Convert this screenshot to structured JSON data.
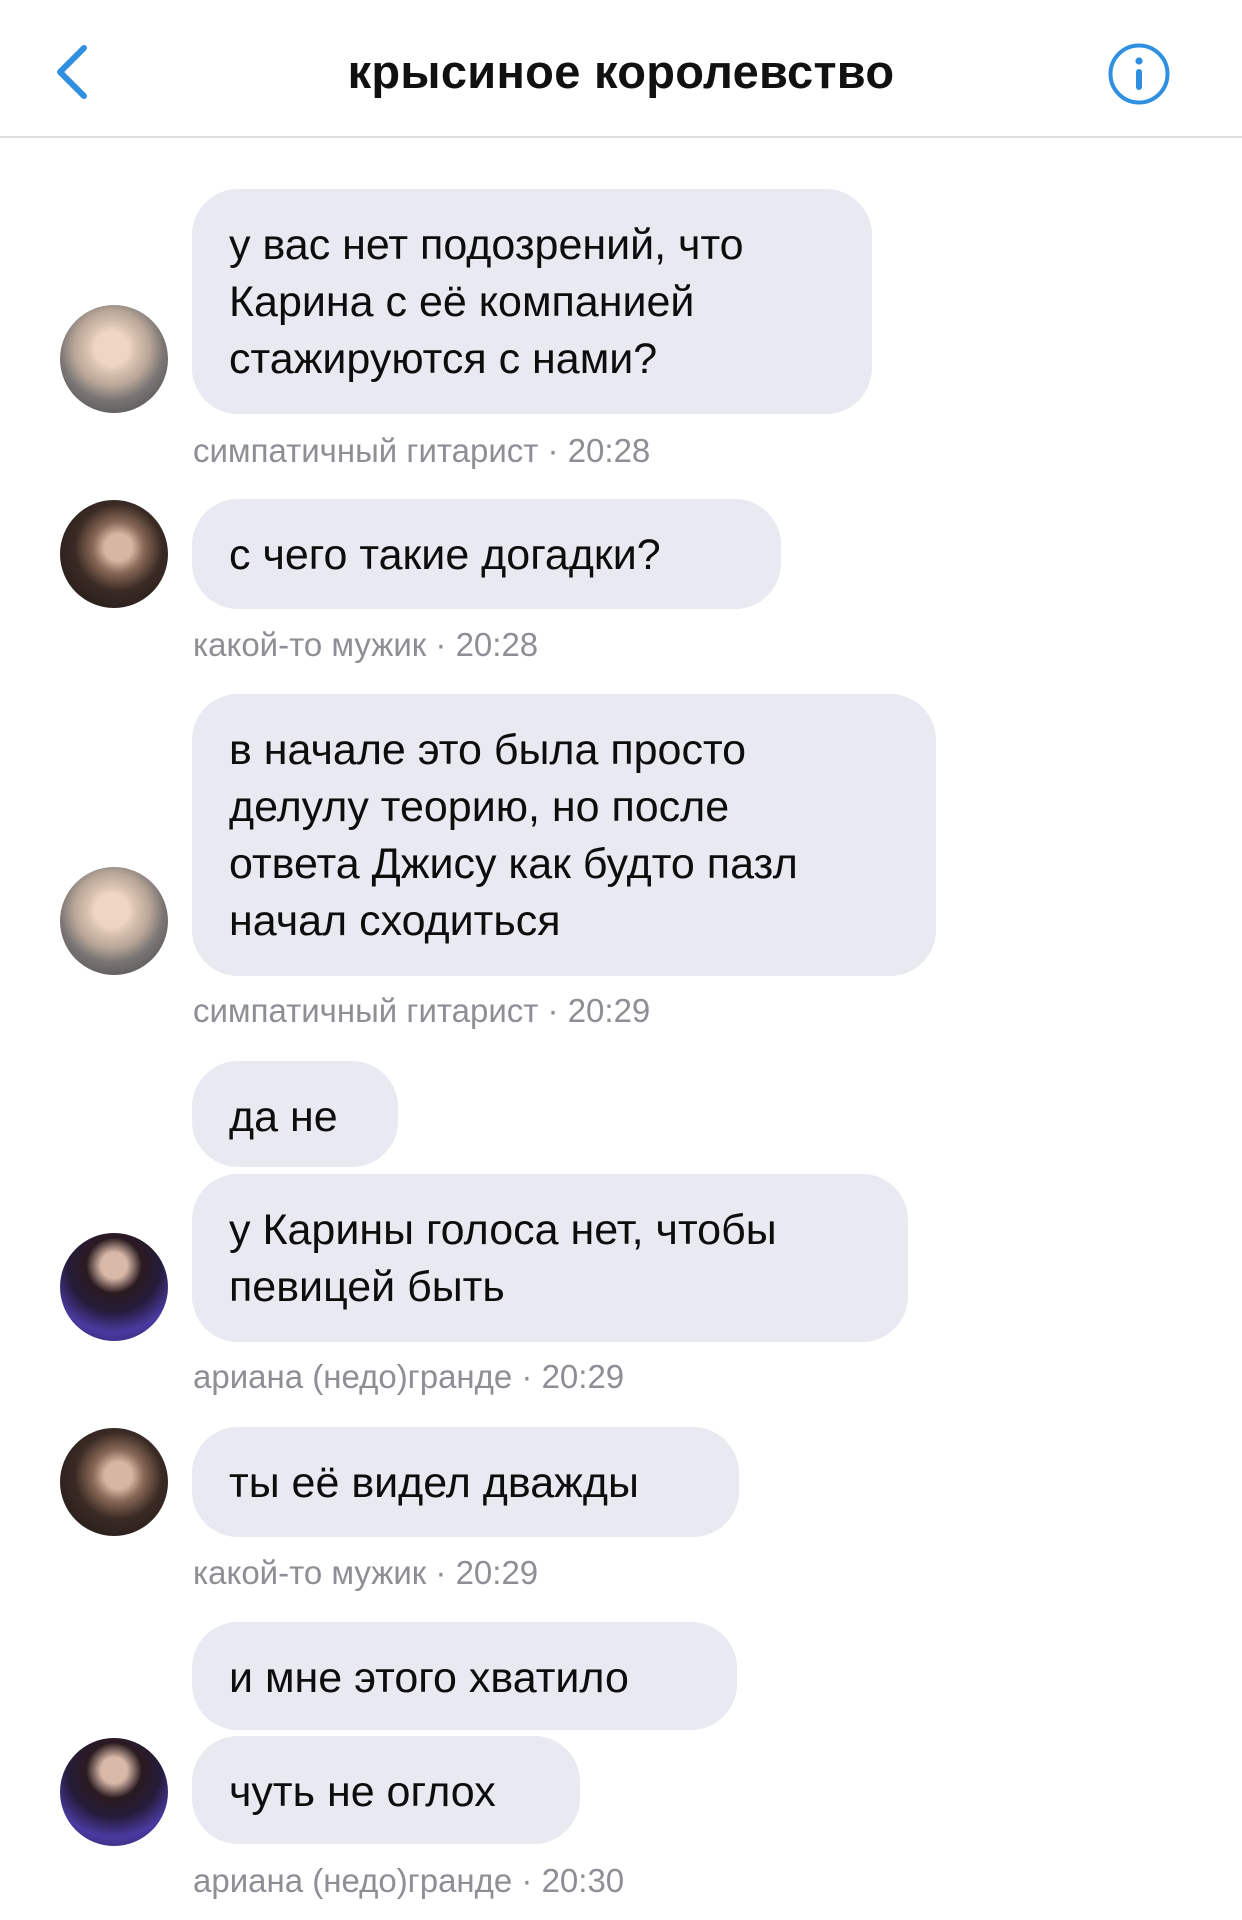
{
  "header": {
    "title": "крысиное королевство",
    "colors": {
      "accent": "#2f8fe0"
    }
  },
  "messages": [
    {
      "bubbles": [
        "у вас нет подозрений, что\nКарина с её компанией\nстажируются с нами?"
      ],
      "sender": "симпатичный гитарист",
      "time": "20:28",
      "meta": "симпатичный гитарист · 20:28"
    },
    {
      "bubbles": [
        "с чего такие догадки?"
      ],
      "sender": "какой-то мужик",
      "time": "20:28",
      "meta": "какой-то мужик · 20:28"
    },
    {
      "bubbles": [
        "в начале это была просто\nделулу теорию, но после\nответа Джису как будто пазл\nначал сходиться"
      ],
      "sender": "симпатичный гитарист",
      "time": "20:29",
      "meta": "симпатичный гитарист · 20:29"
    },
    {
      "bubbles": [
        "да не",
        "у Карины голоса нет, чтобы\nпевицей быть"
      ],
      "sender": "ариана (недо)гранде",
      "time": "20:29",
      "meta": "ариана (недо)гранде  · 20:29"
    },
    {
      "bubbles": [
        "ты её видел дважды"
      ],
      "sender": "какой-то мужик",
      "time": "20:29",
      "meta": "какой-то мужик · 20:29"
    },
    {
      "bubbles": [
        "и мне этого хватило",
        "чуть не оглох"
      ],
      "sender": "ариана (недо)гранде",
      "time": "20:30",
      "meta": "ариана (недо)гранде  · 20:30"
    }
  ]
}
